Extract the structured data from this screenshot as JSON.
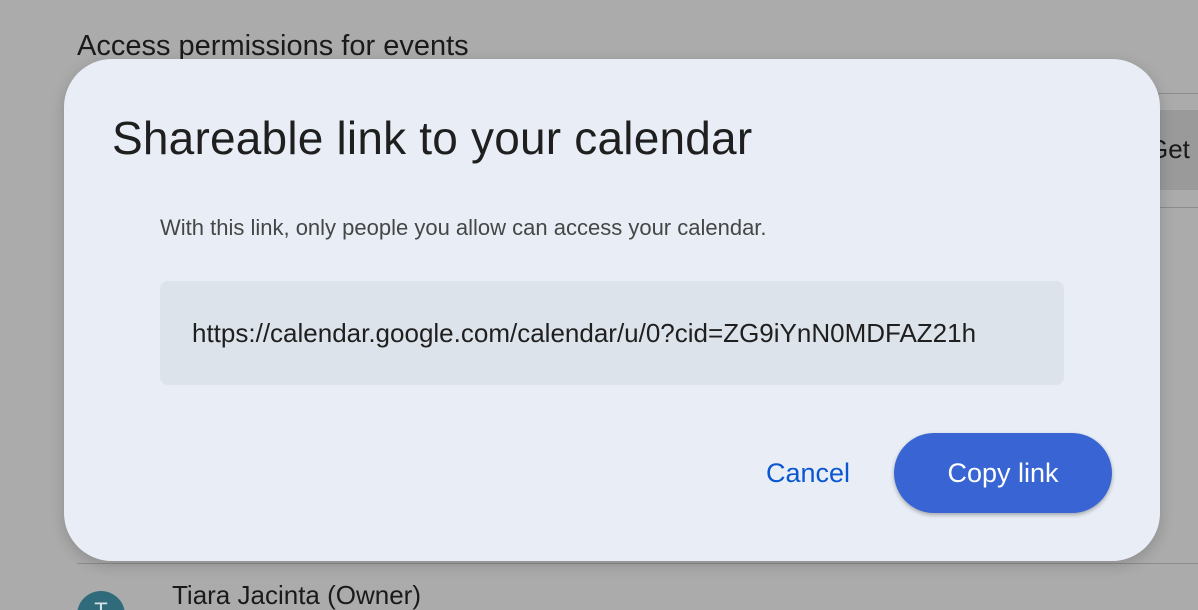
{
  "background": {
    "section_title": "Access permissions for events",
    "details_button_label": "Get details",
    "owner": {
      "avatar_initial": "T",
      "name": "Tiara Jacinta (Owner)"
    }
  },
  "dialog": {
    "title": "Shareable link to your calendar",
    "description": "With this link, only people you allow can access your calendar.",
    "link_value": "https://calendar.google.com/calendar/u/0?cid=ZG9iYnN0MDFAZ21h",
    "cancel_label": "Cancel",
    "copy_label": "Copy link"
  },
  "colors": {
    "scrim": "#ababab",
    "dialog_background": "#e9eef6",
    "link_field_background": "#dde3ea",
    "primary_button": "#3864d4",
    "text_button": "#0b57d0"
  }
}
